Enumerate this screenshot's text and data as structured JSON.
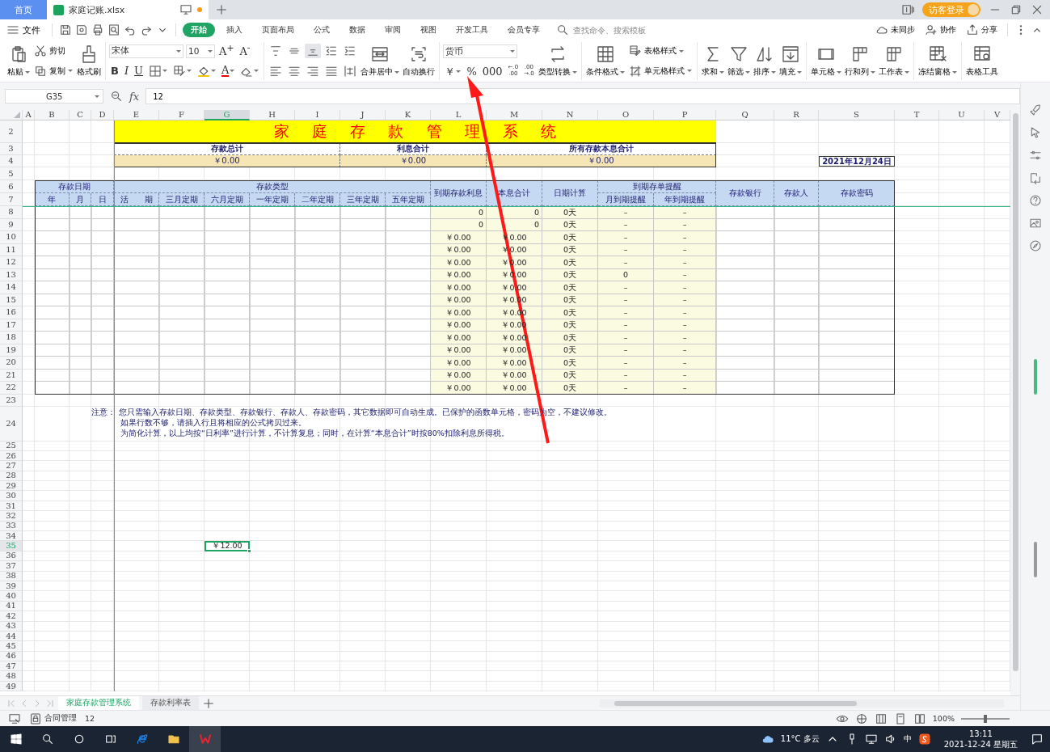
{
  "title_bar": {
    "tabs": [
      {
        "label": "首页",
        "selected": false,
        "unsaved": false
      },
      {
        "label": "家庭记账.xlsx",
        "selected": true,
        "unsaved": true
      }
    ],
    "login": "访客登录"
  },
  "menu": {
    "file": "文件",
    "tabs": [
      {
        "label": "开始",
        "selected": true
      },
      {
        "label": "插入",
        "selected": false
      },
      {
        "label": "页面布局",
        "selected": false
      },
      {
        "label": "公式",
        "selected": false
      },
      {
        "label": "数据",
        "selected": false
      },
      {
        "label": "审阅",
        "selected": false
      },
      {
        "label": "视图",
        "selected": false
      },
      {
        "label": "开发工具",
        "selected": false
      },
      {
        "label": "会员专享",
        "selected": false
      }
    ],
    "search": {
      "placeholder": "查找命令、搜索模板"
    },
    "actions": [
      "未同步",
      "协作",
      "分享"
    ]
  },
  "ribbon": {
    "groups": [
      {
        "columns": [
          [
            [
              {
                "kind": "button",
                "label": "粘贴",
                "dropdown": true
              }
            ]
          ],
          [
            [
              {
                "kind": "button",
                "label": "剪切"
              }
            ],
            [
              {
                "kind": "button",
                "label": "复制",
                "dropdown": true
              }
            ]
          ],
          [
            [
              {
                "kind": "button",
                "label": "格式刷"
              }
            ]
          ]
        ]
      },
      {
        "columns": [
          [
            [
              {
                "kind": "combo",
                "value": "宋体",
                "wide": true
              },
              {
                "kind": "combo",
                "value": "10"
              },
              {
                "kind": "glyph",
                "label": "A$^{+}$"
              },
              {
                "kind": "glyph",
                "label": "A$^{-}$"
              }
            ],
            [
              {
                "kind": "bold",
                "label": "B"
              },
              {
                "kind": "italic",
                "label": "I"
              },
              {
                "kind": "underline",
                "label": "U"
              },
              {
                "kind": "icon",
                "dropdown": true
              },
              {
                "kind": "icon",
                "dropdown": true
              },
              {
                "kind": "icon",
                "dropdown": true
              },
              {
                "kind": "glyph",
                "label": "A",
                "color": "#e8000b",
                "dropdown": true
              },
              {
                "kind": "icon",
                "dropdown": true
              }
            ]
          ]
        ]
      },
      {
        "columns": [
          [
            [
              {
                "kind": "icon",
                "selected": false
              },
              {
                "kind": "icon",
                "selected": false
              },
              {
                "kind": "icon",
                "selected": true
              },
              {
                "kind": "icon"
              },
              {
                "kind": "icon"
              }
            ],
            [
              {
                "kind": "icon"
              },
              {
                "kind": "icon"
              },
              {
                "kind": "icon"
              },
              {
                "kind": "icon"
              },
              {
                "kind": "icon"
              }
            ]
          ],
          [
            [
              {
                "kind": "button",
                "label": "合并居中",
                "dropdown": true
              }
            ]
          ],
          [
            [
              {
                "kind": "button",
                "label": "自动换行"
              }
            ]
          ]
        ]
      },
      {
        "columns": [
          [
            [
              {
                "kind": "combo",
                "value": "货币",
                "wide": true
              }
            ],
            [
              {
                "kind": "glyph",
                "label": "￥",
                "dropdown": true
              },
              {
                "kind": "glyph",
                "label": "%"
              },
              {
                "kind": "glyph",
                "label": "000"
              },
              {
                "kind": "glyph",
                "label": "←.0\n.00"
              },
              {
                "kind": "glyph",
                "label": ".00\n→.0"
              }
            ]
          ],
          [
            [
              {
                "kind": "button",
                "label": "类型转换",
                "dropdown": true
              }
            ]
          ]
        ]
      },
      {
        "columns": [
          [
            [
              {
                "kind": "button",
                "label": "条件格式",
                "dropdown": true
              }
            ]
          ],
          [
            [
              {
                "kind": "button",
                "label": "表格样式",
                "dropdown": true
              }
            ],
            [
              {
                "kind": "button",
                "label": "单元格样式",
                "dropdown": true
              }
            ]
          ]
        ]
      },
      {
        "columns": [
          [
            [
              {
                "kind": "button",
                "label": "求和",
                "dropdown": true
              }
            ]
          ],
          [
            [
              {
                "kind": "button",
                "label": "筛选",
                "dropdown": true
              }
            ]
          ],
          [
            [
              {
                "kind": "button",
                "label": "排序",
                "dropdown": true
              }
            ]
          ],
          [
            [
              {
                "kind": "button",
                "label": "填充",
                "dropdown": true
              }
            ]
          ]
        ]
      },
      {
        "columns": [
          [
            [
              {
                "kind": "button",
                "label": "单元格",
                "dropdown": true
              }
            ]
          ],
          [
            [
              {
                "kind": "button",
                "label": "行和列",
                "dropdown": true
              }
            ]
          ],
          [
            [
              {
                "kind": "button",
                "label": "工作表",
                "dropdown": true
              }
            ]
          ]
        ]
      },
      {
        "columns": [
          [
            [
              {
                "kind": "button",
                "label": "冻结窗格",
                "dropdown": true
              }
            ]
          ]
        ]
      },
      {
        "columns": [
          [
            [
              {
                "kind": "button",
                "label": "表格工具"
              }
            ]
          ]
        ]
      }
    ]
  },
  "formula_bar": {
    "name_box": "G35",
    "function_label": "fx",
    "formula": "12"
  },
  "sheet": {
    "columns": [
      {
        "label": "A",
        "selected": false
      },
      {
        "label": "B",
        "selected": false
      },
      {
        "label": "C",
        "selected": false
      },
      {
        "label": "D",
        "selected": false
      },
      {
        "label": "E",
        "selected": false
      },
      {
        "label": "F",
        "selected": false
      },
      {
        "label": "G",
        "selected": true
      },
      {
        "label": "H",
        "selected": false
      },
      {
        "label": "I",
        "selected": false
      },
      {
        "label": "J",
        "selected": false
      },
      {
        "label": "K",
        "selected": false
      },
      {
        "label": "L",
        "selected": false
      },
      {
        "label": "M",
        "selected": false
      },
      {
        "label": "N",
        "selected": false
      },
      {
        "label": "O",
        "selected": false
      },
      {
        "label": "P",
        "selected": false
      },
      {
        "label": "Q",
        "selected": false
      },
      {
        "label": "R",
        "selected": false
      },
      {
        "label": "S",
        "selected": false
      },
      {
        "label": "T",
        "selected": false
      },
      {
        "label": "U",
        "selected": false
      },
      {
        "label": "V",
        "selected": false
      }
    ],
    "rows": [
      {
        "label": "2",
        "selected": false
      },
      {
        "label": "3",
        "selected": false
      },
      {
        "label": "4",
        "selected": false
      },
      {
        "label": "5",
        "selected": false
      },
      {
        "label": "6",
        "selected": false
      },
      {
        "label": "7",
        "selected": false
      },
      {
        "label": "8",
        "selected": false
      },
      {
        "label": "9",
        "selected": false
      },
      {
        "label": "10",
        "selected": false
      },
      {
        "label": "11",
        "selected": false
      },
      {
        "label": "12",
        "selected": false
      },
      {
        "label": "13",
        "selected": false
      },
      {
        "label": "14",
        "selected": false
      },
      {
        "label": "15",
        "selected": false
      },
      {
        "label": "16",
        "selected": false
      },
      {
        "label": "17",
        "selected": false
      },
      {
        "label": "18",
        "selected": false
      },
      {
        "label": "19",
        "selected": false
      },
      {
        "label": "20",
        "selected": false
      },
      {
        "label": "21",
        "selected": false
      },
      {
        "label": "22",
        "selected": false
      },
      {
        "label": "23",
        "selected": false
      },
      {
        "label": "24",
        "selected": false
      },
      {
        "label": "25",
        "selected": false
      },
      {
        "label": "26",
        "selected": false
      },
      {
        "label": "27",
        "selected": false
      },
      {
        "label": "28",
        "selected": false
      },
      {
        "label": "29",
        "selected": false
      },
      {
        "label": "30",
        "selected": false
      },
      {
        "label": "31",
        "selected": false
      },
      {
        "label": "32",
        "selected": false
      },
      {
        "label": "33",
        "selected": false
      },
      {
        "label": "34",
        "selected": false
      },
      {
        "label": "35",
        "selected": true
      },
      {
        "label": "36",
        "selected": false
      },
      {
        "label": "37",
        "selected": false
      },
      {
        "label": "38",
        "selected": false
      },
      {
        "label": "39",
        "selected": false
      },
      {
        "label": "40",
        "selected": false
      },
      {
        "label": "41",
        "selected": false
      },
      {
        "label": "42",
        "selected": false
      },
      {
        "label": "43",
        "selected": false
      },
      {
        "label": "44",
        "selected": false
      },
      {
        "label": "45",
        "selected": false
      },
      {
        "label": "46",
        "selected": false
      },
      {
        "label": "47",
        "selected": false
      },
      {
        "label": "48",
        "selected": false
      },
      {
        "label": "49",
        "selected": false
      }
    ],
    "title": "家 庭 存 款 管 理 系 统",
    "summary": [
      {
        "label": "存款总计",
        "value": "￥0.00"
      },
      {
        "label": "利息合计",
        "value": "￥0.00"
      },
      {
        "label": "所有存款本息合计",
        "value": "￥0.00"
      }
    ],
    "date": "2021年12月24日",
    "table": {
      "header": [
        {
          "label": "存款日期",
          "children": [
            "年",
            "月",
            "日"
          ]
        },
        {
          "label": "存款类型",
          "children": [
            "活　　期",
            "三月定期",
            "六月定期",
            "一年定期",
            "二年定期",
            "三年定期",
            "五年定期"
          ]
        },
        {
          "label": "到期存款利息"
        },
        {
          "label": "本息合计"
        },
        {
          "label": "日期计算"
        },
        {
          "label": "到期存单提醒",
          "children": [
            "月到期提醒",
            "年到期提醒"
          ]
        },
        {
          "label": "存款银行"
        },
        {
          "label": "存款人"
        },
        {
          "label": "存款密码"
        }
      ],
      "rows": [
        {
          "cells": [
            "0",
            "0",
            "0天",
            "–",
            "–"
          ]
        },
        {
          "cells": [
            "0",
            "0",
            "0天",
            "–",
            "–"
          ]
        },
        {
          "cells": [
            "￥0.00",
            "￥0.00",
            "0天",
            "–",
            "–"
          ]
        },
        {
          "cells": [
            "￥0.00",
            "￥0.00",
            "0天",
            "–",
            "–"
          ]
        },
        {
          "cells": [
            "￥0.00",
            "￥0.00",
            "0天",
            "–",
            "–"
          ]
        },
        {
          "cells": [
            "￥0.00",
            "￥0.00",
            "0天",
            "0",
            "–"
          ]
        },
        {
          "cells": [
            "￥0.00",
            "￥0.00",
            "0天",
            "–",
            "–"
          ]
        },
        {
          "cells": [
            "￥0.00",
            "￥0.00",
            "0天",
            "–",
            "–"
          ]
        },
        {
          "cells": [
            "￥0.00",
            "￥0.00",
            "0天",
            "–",
            "–"
          ]
        },
        {
          "cells": [
            "￥0.00",
            "￥0.00",
            "0天",
            "–",
            "–"
          ]
        },
        {
          "cells": [
            "￥0.00",
            "￥0.00",
            "0天",
            "–",
            "–"
          ]
        },
        {
          "cells": [
            "￥0.00",
            "￥0.00",
            "0天",
            "–",
            "–"
          ]
        },
        {
          "cells": [
            "￥0.00",
            "￥0.00",
            "0天",
            "–",
            "–"
          ]
        },
        {
          "cells": [
            "￥0.00",
            "￥0.00",
            "0天",
            "–",
            "–"
          ]
        },
        {
          "cells": [
            "￥0.00",
            "￥0.00",
            "0天",
            "–",
            "–"
          ]
        }
      ]
    },
    "notes": {
      "label": "注意：",
      "lines": [
        "您只需输入存款日期、存款类型、存款银行、存款人、存款密码，其它数据即可自动生成。已保护的函数单元格，密码为空，不建议修改。",
        "如果行数不够，请插入行且将相应的公式拷贝过来。",
        "为简化计算，以上均按“日利率”进行计算，不计算复息；同时，在计算“本息合计”时按80%扣除利息所得税。"
      ]
    },
    "active_cell": {
      "value": "￥12.00"
    }
  },
  "sheet_tabs": [
    {
      "label": "家庭存款管理系统",
      "selected": true
    },
    {
      "label": "存款利率表",
      "selected": false
    }
  ],
  "status_bar": {
    "items": [
      "合同管理",
      "12"
    ],
    "zoom": "100%",
    "zoom_slider": {
      "level": 0.5
    }
  },
  "taskbar": {
    "weather": "11°C 多云",
    "ime": "中",
    "time": "13:11",
    "date": "2021-12-24 星期五"
  }
}
